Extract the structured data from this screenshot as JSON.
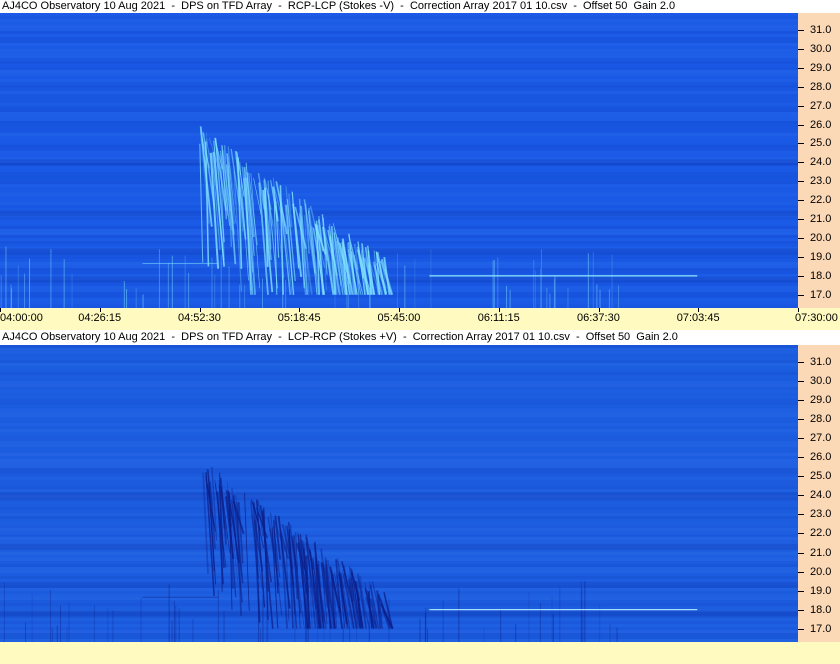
{
  "colors": {
    "panel_top_bg": "#1a5ae6",
    "panel_bottom_bg": "#1d5ee0",
    "emission_top": "#7fe3ff",
    "emission_bottom": "#0b1f8a",
    "freq_axis_bg": "#fcd9b6",
    "time_axis_bg": "#fffbc0"
  },
  "chart_data": [
    {
      "type": "heatmap",
      "title": "AJ4CO Observatory 10 Aug 2021  -  DPS on TFD Array  -  RCP-LCP (Stokes -V)  -  Correction Array 2017 01 10.csv  -  Offset 50  Gain 2.0",
      "y_ticks": [
        "31.0",
        "30.0",
        "29.0",
        "28.0",
        "27.0",
        "26.0",
        "25.0",
        "24.0",
        "23.0",
        "22.0",
        "21.0",
        "20.0",
        "19.0",
        "18.0",
        "17.0"
      ],
      "y_range": [
        16.3,
        31.9
      ],
      "x_ticks": [
        "04:00:00",
        "04:26:15",
        "04:52:30",
        "05:18:45",
        "05:45:00",
        "06:11:15",
        "06:37:30",
        "07:03:45",
        "07:30:00"
      ],
      "x_range": [
        "04:00:00",
        "07:30:00"
      ],
      "features": {
        "burst_start_time": "04:52:30",
        "burst_end_time": "05:50:00",
        "burst_freq_max": 26.0,
        "burst_freq_min": 17.0,
        "carrier_freq": 18.0,
        "carrier_start": "05:53:00",
        "carrier_end": "07:03:30"
      }
    },
    {
      "type": "heatmap",
      "title": "AJ4CO Observatory 10 Aug 2021  -  DPS on TFD Array  -  LCP-RCP (Stokes +V)  -  Correction Array 2017 01 10.csv  -  Offset 50  Gain 2.0",
      "y_ticks": [
        "31.0",
        "30.0",
        "29.0",
        "28.0",
        "27.0",
        "26.0",
        "25.0",
        "24.0",
        "23.0",
        "22.0",
        "21.0",
        "20.0",
        "19.0",
        "18.0",
        "17.0"
      ],
      "y_range": [
        16.3,
        31.9
      ],
      "x_ticks": [],
      "x_range": [
        "04:00:00",
        "07:30:00"
      ],
      "features": {
        "burst_start_time": "04:52:30",
        "burst_end_time": "05:50:00",
        "burst_freq_max": 26.0,
        "burst_freq_min": 17.0,
        "carrier_freq": 18.0,
        "carrier_start": "05:53:00",
        "carrier_end": "07:03:30"
      }
    }
  ]
}
